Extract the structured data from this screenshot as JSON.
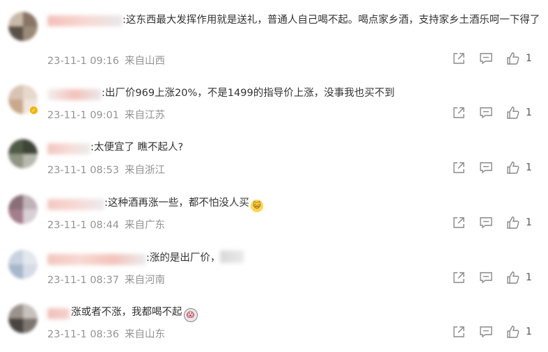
{
  "comments": [
    {
      "text": ":这东西最大发挥作用就是送礼，普通人自己喝不起。喝点家乡酒，支持家乡土酒乐呵一下得了",
      "date": "23-11-1 09:16",
      "location": "来自山西",
      "likes": "1"
    },
    {
      "text": ":出厂价969上涨20%，不是1499的指导价上涨，没事我也买不到",
      "date": "23-11-1 09:01",
      "location": "来自江苏",
      "likes": "1"
    },
    {
      "text": ":太便宜了 瞧不起人?",
      "date": "23-11-1 08:53",
      "location": "来自浙江",
      "likes": "1"
    },
    {
      "text": ":这种酒再涨一些，都不怕没人买",
      "date": "23-11-1 08:44",
      "location": "来自广东",
      "likes": "1"
    },
    {
      "text": ":涨的是出厂价，",
      "date": "23-11-1 08:37",
      "location": "来自河南",
      "likes": "1"
    },
    {
      "text": "涨或者不涨，我都喝不起",
      "date": "23-11-1 08:36",
      "location": "来自山东",
      "likes": "1"
    }
  ],
  "icons": {
    "share": "share-icon",
    "comment": "comment-icon",
    "like": "thumbs-up-icon",
    "cat_emoji": "cat-face-emoji",
    "shock_emoji": "shocked-face-emoji"
  },
  "colors": {
    "text": "#333333",
    "meta": "#939393",
    "icon": "#888888"
  }
}
